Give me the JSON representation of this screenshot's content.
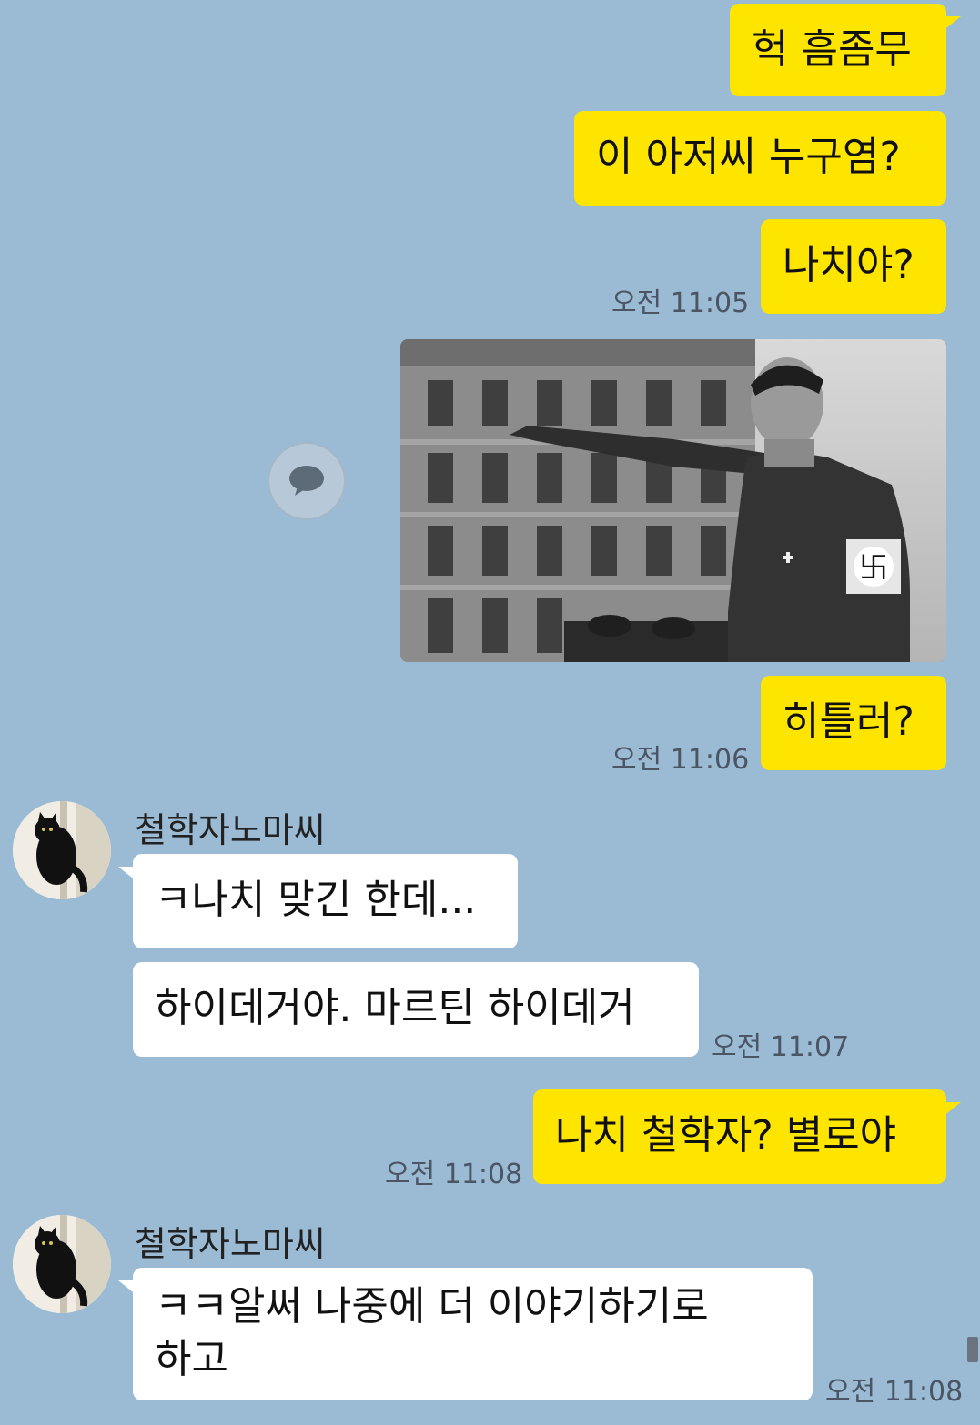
{
  "messages": {
    "m1": "헉 흠좀무",
    "m2": "이 아저씨 누구염?",
    "m3": "나치야?",
    "t1": "오전 11:05",
    "m4": "히틀러?",
    "t2": "오전 11:06",
    "sender1": "철학자노마씨",
    "r1": "ㅋ나치 맞긴 한데...",
    "r2": "하이데거야. 마르틴 하이데거",
    "t3": "오전 11:07",
    "m5": "나치 철학자? 별로야",
    "t4": "오전 11:08",
    "sender2": "철학자노마씨",
    "r3_line1": "ㅋㅋ알써  나중에 더 이야기하기로",
    "r3_line2": "하고",
    "t5": "오전 11:08"
  },
  "icons": {
    "share": "share-chat-icon",
    "avatar": "black-cat-avatar"
  },
  "colors": {
    "background": "#9bbbd4",
    "my_bubble": "#fee500",
    "their_bubble": "#ffffff"
  }
}
